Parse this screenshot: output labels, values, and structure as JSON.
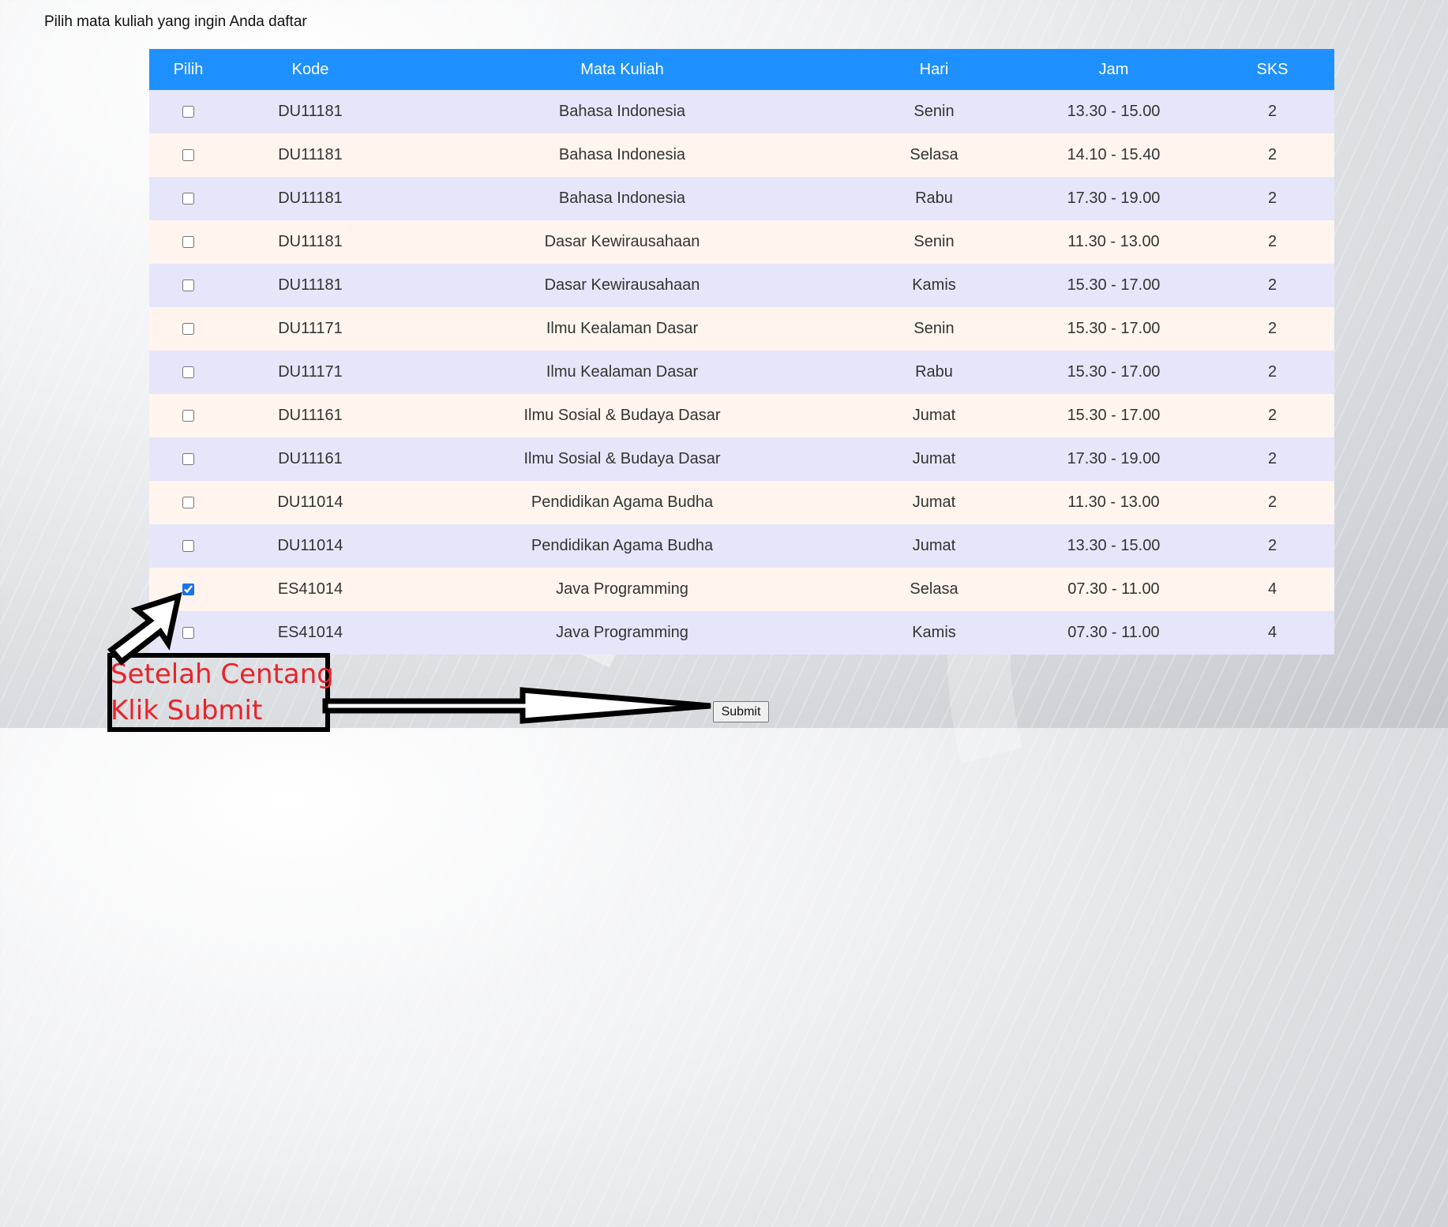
{
  "instruction": "Pilih mata kuliah yang ingin Anda daftar",
  "table": {
    "headers": [
      "Pilih",
      "Kode",
      "Mata Kuliah",
      "Hari",
      "Jam",
      "SKS"
    ],
    "rows": [
      {
        "checked": false,
        "kode": "DU11181",
        "mata_kuliah": "Bahasa Indonesia",
        "hari": "Senin",
        "jam": "13.30 - 15.00",
        "sks": "2"
      },
      {
        "checked": false,
        "kode": "DU11181",
        "mata_kuliah": "Bahasa Indonesia",
        "hari": "Selasa",
        "jam": "14.10 - 15.40",
        "sks": "2"
      },
      {
        "checked": false,
        "kode": "DU11181",
        "mata_kuliah": "Bahasa Indonesia",
        "hari": "Rabu",
        "jam": "17.30 - 19.00",
        "sks": "2"
      },
      {
        "checked": false,
        "kode": "DU11181",
        "mata_kuliah": "Dasar Kewirausahaan",
        "hari": "Senin",
        "jam": "11.30 - 13.00",
        "sks": "2"
      },
      {
        "checked": false,
        "kode": "DU11181",
        "mata_kuliah": "Dasar Kewirausahaan",
        "hari": "Kamis",
        "jam": "15.30 - 17.00",
        "sks": "2"
      },
      {
        "checked": false,
        "kode": "DU11171",
        "mata_kuliah": "Ilmu Kealaman Dasar",
        "hari": "Senin",
        "jam": "15.30 - 17.00",
        "sks": "2"
      },
      {
        "checked": false,
        "kode": "DU11171",
        "mata_kuliah": "Ilmu Kealaman Dasar",
        "hari": "Rabu",
        "jam": "15.30 - 17.00",
        "sks": "2"
      },
      {
        "checked": false,
        "kode": "DU11161",
        "mata_kuliah": "Ilmu Sosial & Budaya Dasar",
        "hari": "Jumat",
        "jam": "15.30 - 17.00",
        "sks": "2"
      },
      {
        "checked": false,
        "kode": "DU11161",
        "mata_kuliah": "Ilmu Sosial & Budaya Dasar",
        "hari": "Jumat",
        "jam": "17.30 - 19.00",
        "sks": "2"
      },
      {
        "checked": false,
        "kode": "DU11014",
        "mata_kuliah": "Pendidikan Agama Budha",
        "hari": "Jumat",
        "jam": "11.30 - 13.00",
        "sks": "2"
      },
      {
        "checked": false,
        "kode": "DU11014",
        "mata_kuliah": "Pendidikan Agama Budha",
        "hari": "Jumat",
        "jam": "13.30 - 15.00",
        "sks": "2"
      },
      {
        "checked": true,
        "kode": "ES41014",
        "mata_kuliah": "Java Programming",
        "hari": "Selasa",
        "jam": "07.30 - 11.00",
        "sks": "4"
      },
      {
        "checked": false,
        "kode": "ES41014",
        "mata_kuliah": "Java Programming",
        "hari": "Kamis",
        "jam": "07.30 - 11.00",
        "sks": "4"
      }
    ]
  },
  "submit_label": "Submit",
  "annotation": {
    "line1": "Setelah Centang",
    "line2": "Klik Submit",
    "text_color": "#e8232a",
    "border_color": "#000000"
  },
  "colors": {
    "header_bg": "#1e90ff",
    "row_odd": "#e6e6fa",
    "row_even": "#fff5ee"
  }
}
